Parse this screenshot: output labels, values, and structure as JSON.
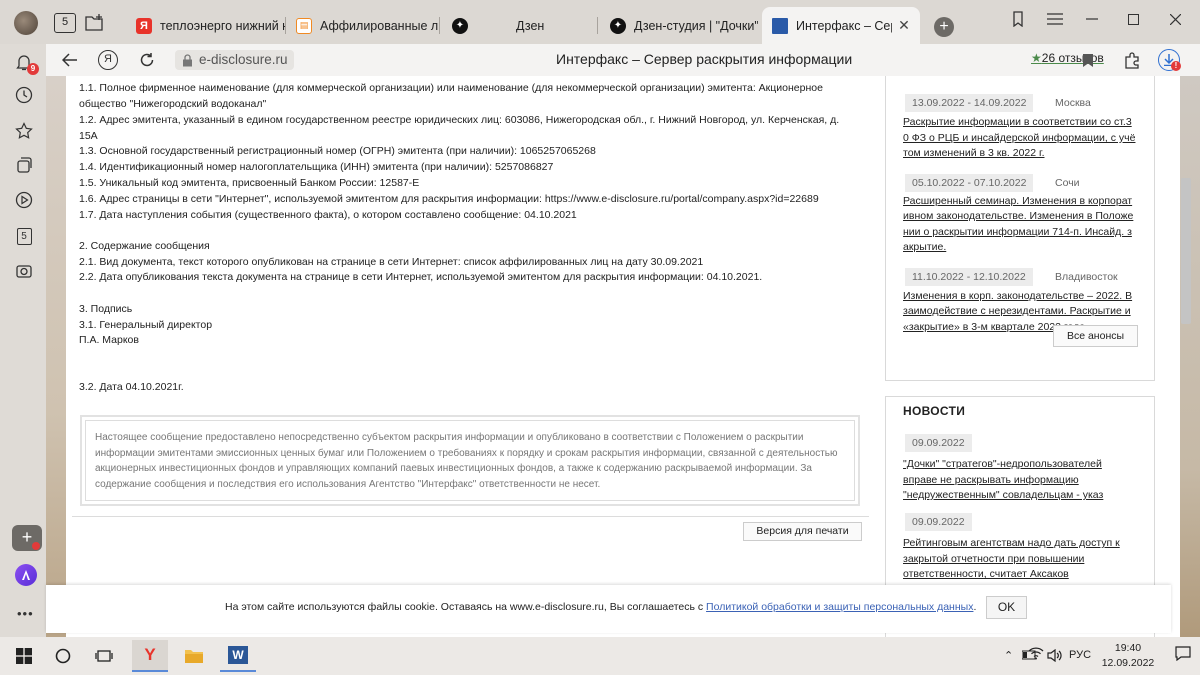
{
  "tabs": [
    {
      "title": "теплоэнерго нижний н",
      "icon": "yandex-icon",
      "color": "#e8332a"
    },
    {
      "title": "Аффилированные лиц",
      "icon": "doc-icon",
      "color": "#f08a24"
    },
    {
      "title": "Дзен",
      "icon": "dzen-icon",
      "color": "#111111"
    },
    {
      "title": "Дзен-студия | \"Дочки\"",
      "icon": "dzen-icon",
      "color": "#111111"
    },
    {
      "title": "Интерфакс – Серве",
      "icon": "interfax-icon",
      "color": "#2a5aa8"
    }
  ],
  "tab_counter": "5",
  "address": {
    "url": "e-disclosure.ru",
    "heading": "Интерфакс – Сервер раскрытия информации",
    "reviews": "26 отзывов"
  },
  "sidebar": {
    "notification_badge": "9"
  },
  "main": {
    "lines": [
      "1.1. Полное фирменное наименование (для коммерческой организации) или наименование (для некоммерческой организации) эмитента: Акционерное",
      "общество \"Нижегородский водоканал\"",
      "1.2. Адрес эмитента, указанный в едином государственном реестре юридических лиц: 603086, Нижегородская обл., г. Нижний Новгород, ул. Керченская, д.",
      "15А",
      "1.3. Основной государственный регистрационный номер (ОГРН) эмитента (при наличии): 1065257065268",
      "1.4. Идентификационный номер налогоплательщика (ИНН) эмитента (при наличии): 5257086827",
      "1.5. Уникальный код эмитента, присвоенный Банком России: 12587-E",
      "1.6. Адрес страницы в сети \"Интернет\", используемой эмитентом для раскрытия информации: https://www.e-disclosure.ru/portal/company.aspx?id=22689",
      "1.7. Дата наступления события (существенного факта), о котором составлено сообщение: 04.10.2021",
      "2. Содержание сообщения",
      "2.1. Вид документа, текст которого опубликован на странице в сети Интернет: список аффилированных лиц на дату 30.09.2021",
      "2.2. Дата опубликования текста документа на странице в сети Интернет, используемой эмитентом для раскрытия информации: 04.10.2021.",
      "3. Подпись",
      "3.1. Генеральный директор",
      "П.А. Марков",
      "3.2. Дата 04.10.2021г."
    ],
    "disclaimer": "Настоящее сообщение предоставлено непосредственно субъектом раскрытия информации и опубликовано в соответствии с Положением о раскрытии информации эмитентами эмиссионных ценных бумаг или Положением о требованиях к порядку и срокам раскрытия информации, связанной с деятельностью акционерных инвестиционных фондов и управляющих компаний паевых инвестиционных фондов, а также к содержанию раскрываемой информации. За содержание сообщения и последствия его использования Агентство \"Интерфакс\" ответственности не несет.",
    "print_button": "Версия для печати"
  },
  "announcements": {
    "items": [
      {
        "date": "13.09.2022 - 14.09.2022",
        "city": "Москва",
        "lines": [
          "Раскрытие информации в соответствии со ст.3",
          "0 ФЗ о РЦБ и инсайдерской информации, с учё",
          "том изменений в 3 кв. 2022 г."
        ]
      },
      {
        "date": "05.10.2022 - 07.10.2022",
        "city": "Сочи",
        "lines": [
          "Расширенный семинар. Изменения в корпорат",
          "ивном законодательстве. Изменения в Положе",
          "нии о раскрытии информации 714-п. Инсайд. з",
          "акрытие."
        ]
      },
      {
        "date": "11.10.2022 - 12.10.2022",
        "city": "Владивосток",
        "lines": [
          "Изменения в корп. законодательстве – 2022. В",
          "заимодействие с нерезидентами. Раскрытие и",
          "«закрытие» в 3-м квартале 2022 года"
        ]
      }
    ],
    "all_button": "Все анонсы"
  },
  "news": {
    "title": "НОВОСТИ",
    "items": [
      {
        "date": "09.09.2022",
        "lines": [
          "\"Дочки\" \"стратегов\"-недропользователей",
          "вправе не раскрывать информацию",
          "\"недружественным\" совладельцам - указ"
        ]
      },
      {
        "date": "09.09.2022",
        "lines": [
          "Рейтинговым агентствам надо дать доступ к",
          "закрытой отчетности при повышении",
          "ответственности, считает Аксаков"
        ]
      }
    ]
  },
  "cookie": {
    "text": "На этом сайте используются файлы cookie. Оставаясь на www.e-disclosure.ru, Вы соглашаетесь с ",
    "link": "Политикой обработки и защиты персональных данных",
    "suffix": ".",
    "ok": "OK"
  },
  "taskbar": {
    "lang": "РУС",
    "time": "19:40",
    "date": "12.09.2022"
  }
}
